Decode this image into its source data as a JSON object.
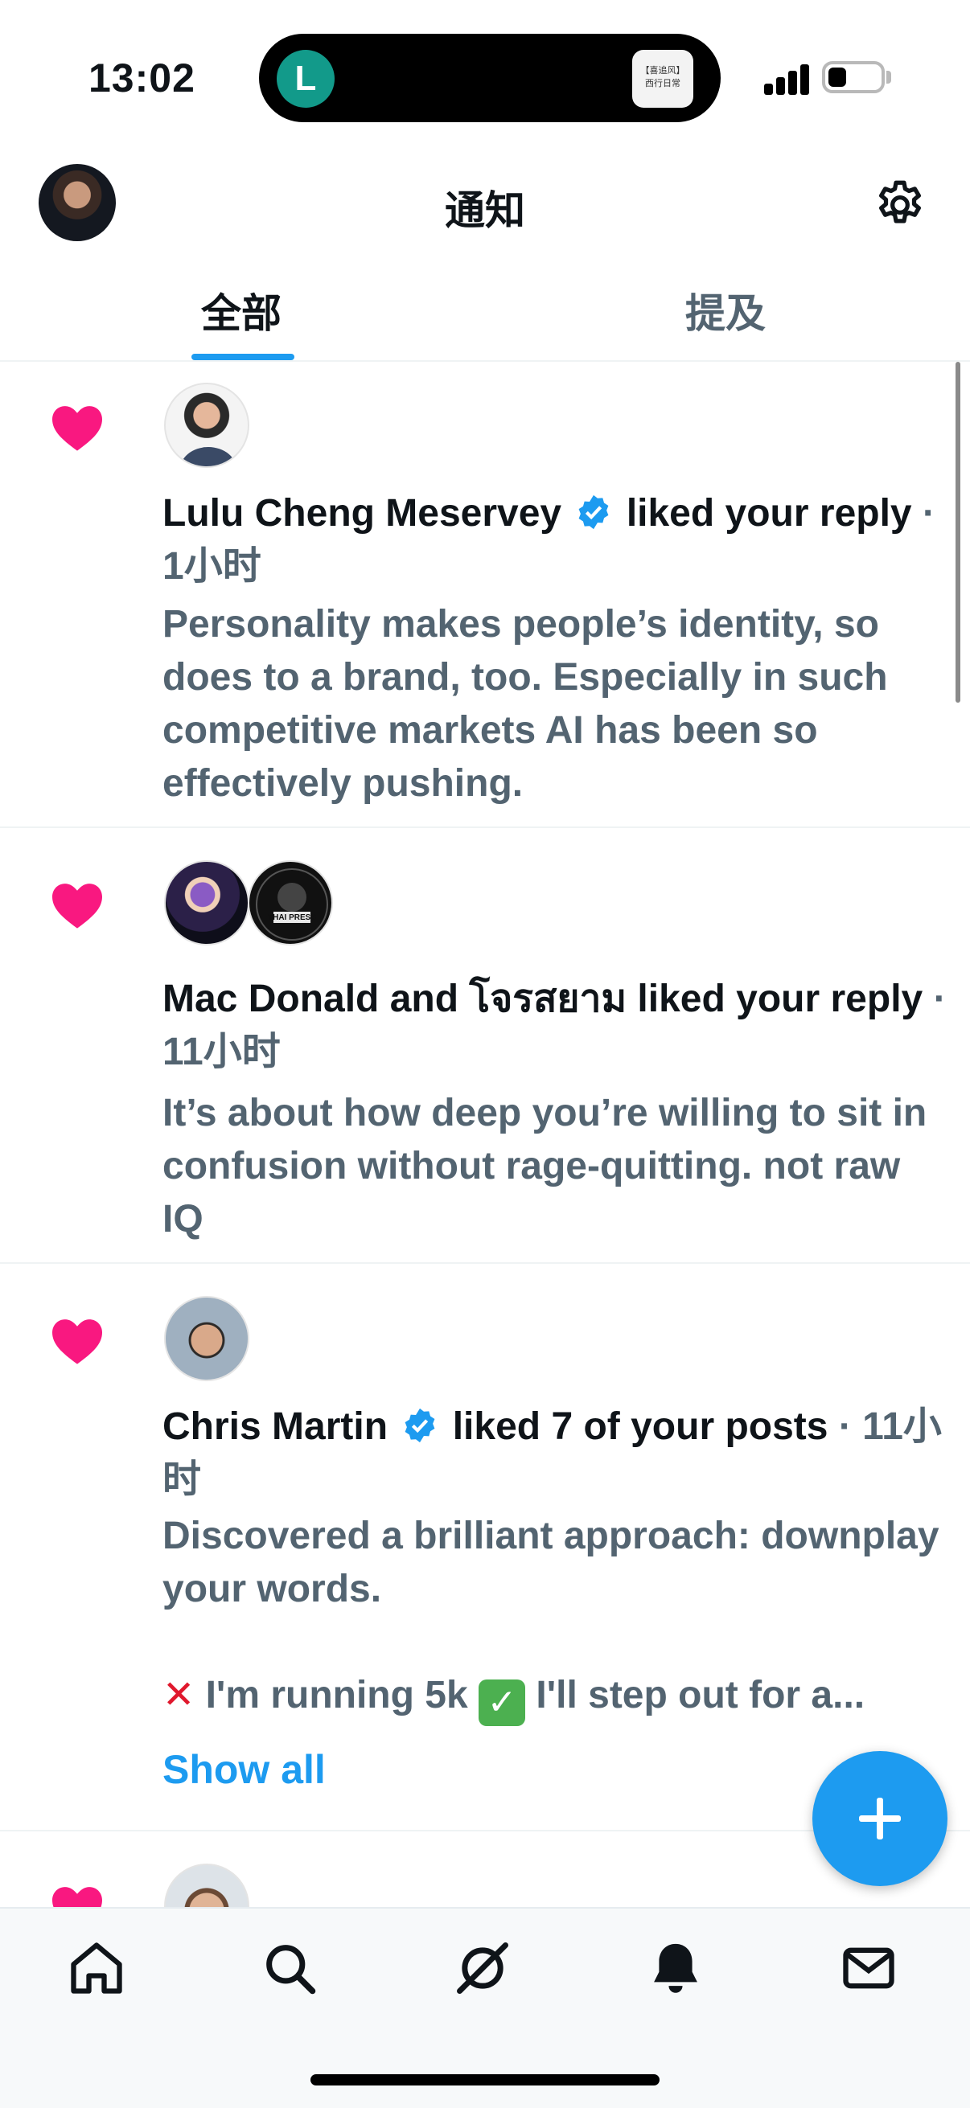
{
  "status_bar": {
    "time": "13:02",
    "island_app_letter": "L",
    "island_widget_line1": "【喜追风】",
    "island_widget_line2": "西行日常"
  },
  "header": {
    "title": "通知"
  },
  "tabs": [
    {
      "label": "全部",
      "active": true
    },
    {
      "label": "提及",
      "active": false
    }
  ],
  "notifications": [
    {
      "name": "Lulu Cheng Meservey",
      "verified": true,
      "action": "liked your reply",
      "time": "· 1小时",
      "text": "Personality makes people’s identity, so does to a brand, too. Especially in such competitive markets AI has been so effectively pushing."
    },
    {
      "name": "Mac Donald and โจรสยาม",
      "verified": false,
      "action": "liked your reply",
      "time": "· 11小时",
      "text": "It’s about how deep you’re willing to sit in confusion without rage-quitting. not raw IQ"
    },
    {
      "name": "Chris Martin",
      "verified": true,
      "action": "liked 7 of your posts",
      "time": "· 11小时",
      "text": "Discovered a brilliant approach: downplay your words.",
      "text2_part1": "I'm running 5k",
      "text2_part2": "I'll step out for a...",
      "show_all": "Show all"
    }
  ],
  "avatar_labels": {
    "thai_press": "THAI PRESS"
  },
  "colors": {
    "accent": "#1d9bf0",
    "heart": "#f91880",
    "muted": "#536471"
  },
  "icons": [
    "home-icon",
    "search-icon",
    "grok-icon",
    "notifications-bell-icon",
    "messages-icon",
    "settings-gear-icon",
    "heart-icon",
    "verified-badge-icon",
    "compose-plus-icon"
  ]
}
